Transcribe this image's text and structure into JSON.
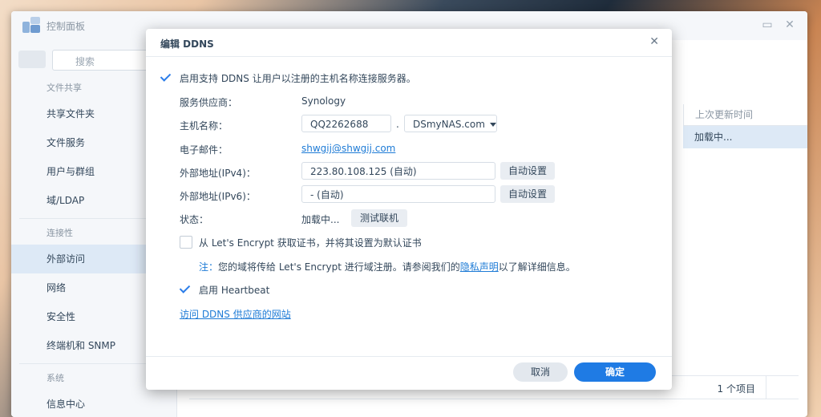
{
  "window": {
    "title": "控制面板",
    "search_placeholder": "搜索",
    "sidebar": {
      "cat_file_sharing": "文件共享",
      "items_file": [
        "共享文件夹",
        "文件服务",
        "用户与群组",
        "域/LDAP"
      ],
      "cat_connectivity": "连接性",
      "items_conn": [
        "外部访问",
        "网络",
        "安全性",
        "终端机和 SNMP"
      ],
      "cat_system": "系统",
      "item_system_partial": "信息中心"
    },
    "table": {
      "col_last_update": "上次更新时间",
      "row_status": "加载中..."
    },
    "footer_count": "1 个项目"
  },
  "dialog": {
    "title": "编辑 DDNS",
    "enable_label": "启用支持 DDNS 让用户以注册的主机名称连接服务器。",
    "provider_label": "服务供应商：",
    "provider_value": "Synology",
    "hostname_label": "主机名称：",
    "hostname_value": "QQ2262688",
    "dot": ".",
    "domain_value": "DSmyNAS.com",
    "email_label": "电子邮件：",
    "email_value": "shwgij@shwgij.com",
    "ipv4_label": "外部地址(IPv4)：",
    "ipv4_value": "223.80.108.125 (自动)",
    "ipv6_label": "外部地址(IPv6)：",
    "ipv6_value": "- (自动)",
    "auto_set": "自动设置",
    "status_label": "状态：",
    "status_value": "加载中...",
    "test_button": "测试联机",
    "le_label": "从 Let's Encrypt 获取证书，并将其设置为默认证书",
    "note_prefix": "注：",
    "note_text": "您的域将传给 Let's Encrypt 进行域注册。请参阅我们的",
    "note_link": "隐私声明",
    "note_suffix": "以了解详细信息。",
    "heartbeat_label": "启用 Heartbeat",
    "visit_link": "访问 DDNS 供应商的网站",
    "cancel": "取消",
    "ok": "确定",
    "colors": {
      "primary": "#1f7be4",
      "link": "#1e7bd6"
    }
  }
}
